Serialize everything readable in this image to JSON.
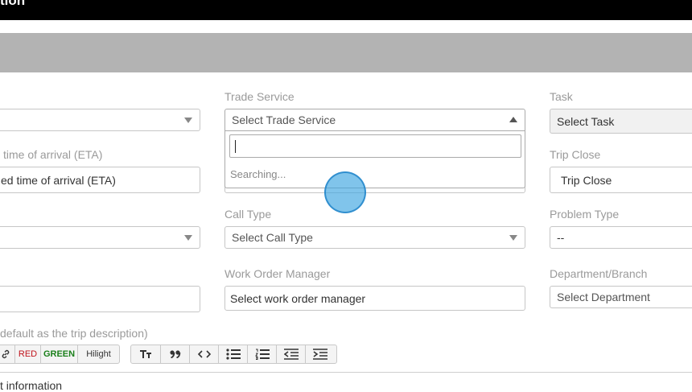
{
  "header": {
    "title": "tion"
  },
  "form": {
    "trade_service": {
      "label": "Trade Service",
      "placeholder": "Select Trade Service"
    },
    "task": {
      "label": "Task",
      "value": "Select Task"
    },
    "eta": {
      "label": "time of arrival (ETA)",
      "value": "ed time of arrival (ETA)"
    },
    "trip_close": {
      "label": "Trip Close",
      "value": "Trip Close"
    },
    "call_type": {
      "label": "Call Type",
      "placeholder": "Select Call Type"
    },
    "problem_type": {
      "label": "Problem Type",
      "value": "--"
    },
    "work_order_manager": {
      "label": "Work Order Manager",
      "placeholder": "Select work order manager"
    },
    "department": {
      "label": "Department/Branch",
      "placeholder": "Select Department"
    },
    "description": {
      "label": "default as the trip description)",
      "content": "t information"
    }
  },
  "dropdown": {
    "search_value": "",
    "status": "Searching..."
  },
  "toolbar": {
    "red": "RED",
    "green": "GREEN",
    "hilight": "Hilight",
    "colors": {
      "red": "#c0141c",
      "green": "#1a7f1a"
    }
  },
  "icons": [
    "link-icon",
    "text-size-icon",
    "quote-icon",
    "code-icon",
    "bullet-list-icon",
    "numbered-list-icon",
    "outdent-icon",
    "indent-icon",
    "caret-down-icon",
    "caret-up-icon"
  ]
}
